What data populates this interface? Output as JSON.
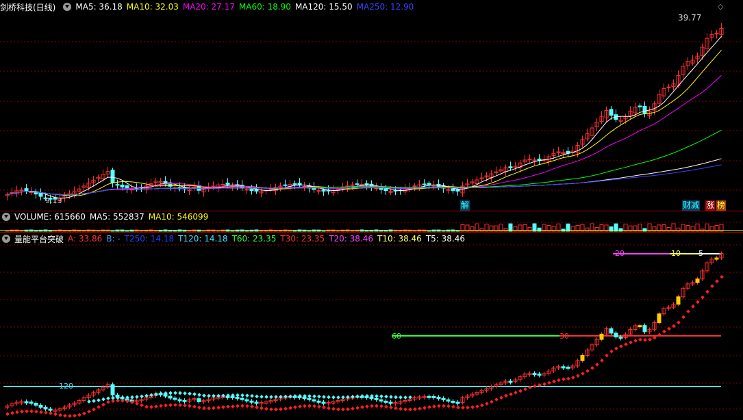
{
  "main": {
    "title": "剑桥科技(日线)",
    "ma": [
      {
        "label": "MA5: 36.18",
        "color": "#ffffff"
      },
      {
        "label": "MA10: 32.03",
        "color": "#ffff00"
      },
      {
        "label": "MA20: 27.17",
        "color": "#ff00ff"
      },
      {
        "label": "MA60: 18.90",
        "color": "#00ff00"
      },
      {
        "label": "MA120: 15.50",
        "color": "#ffffff"
      },
      {
        "label": "MA250: 12.90",
        "color": "#4040ff"
      }
    ],
    "high_label": "39.77",
    "low_label": "9.13",
    "tag_jie": "解",
    "tag_caijian": "财减",
    "tag_zhang": "涨",
    "tag_bang": "榜"
  },
  "volume": {
    "title": "VOLUME: 615660",
    "ma5": "MA5: 552837",
    "ma10": "MA10: 546099"
  },
  "indicator": {
    "title": "量能平台突破",
    "items": [
      {
        "label": "A: 33.86",
        "color": "#ff3030"
      },
      {
        "label": "B: -",
        "color": "#30a0ff"
      },
      {
        "label": "T250: 14.18",
        "color": "#2040ff"
      },
      {
        "label": "T120: 14.18",
        "color": "#40e0ff"
      },
      {
        "label": "T60: 23.35",
        "color": "#30ff30"
      },
      {
        "label": "T30: 23.35",
        "color": "#ff3030"
      },
      {
        "label": "T20: 38.46",
        "color": "#ff40ff"
      },
      {
        "label": "T10: 38.46",
        "color": "#ffff60"
      },
      {
        "label": "T5: 38.46",
        "color": "#ffffff"
      }
    ],
    "level_labels": [
      "120",
      "60",
      "30",
      "20",
      "10",
      "5"
    ]
  },
  "chart_data": {
    "type": "candlestick",
    "title": "剑桥科技(日线)",
    "price_high": 39.77,
    "price_low": 9.13,
    "ma_last": {
      "MA5": 36.18,
      "MA10": 32.03,
      "MA20": 27.17,
      "MA60": 18.9,
      "MA120": 15.5,
      "MA250": 12.9
    },
    "volume_last": 615660,
    "volume_ma5": 552837,
    "volume_ma10": 546099,
    "indicator_last": {
      "A": 33.86,
      "T250": 14.18,
      "T120": 14.18,
      "T60": 23.35,
      "T30": 23.35,
      "T20": 38.46,
      "T10": 38.46,
      "T5": 38.46
    }
  },
  "colors": {
    "up": "#ff3030",
    "down": "#54ffff",
    "grid": "#8b0000",
    "separator": "#b00000"
  }
}
